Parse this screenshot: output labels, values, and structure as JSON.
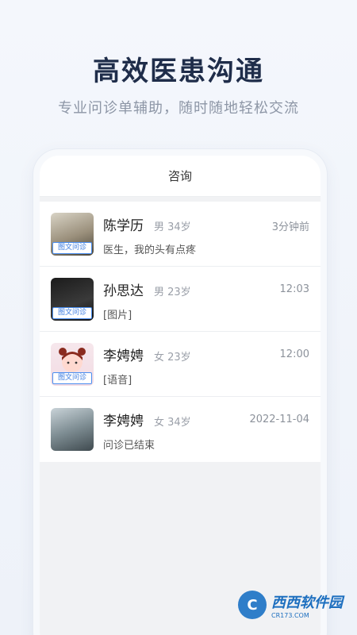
{
  "headline": "高效医患沟通",
  "subline": "专业问诊单辅助，随时随地轻松交流",
  "phone": {
    "nav_title": "咨询",
    "consults": [
      {
        "name": "陈学历",
        "meta": "男 34岁",
        "time": "3分钟前",
        "preview": "医生，我的头有点疼",
        "badge": "图文问诊"
      },
      {
        "name": "孙思达",
        "meta": "男 23岁",
        "time": "12:03",
        "preview": "[图片]",
        "badge": "图文问诊"
      },
      {
        "name": "李娉娉",
        "meta": "女 23岁",
        "time": "12:00",
        "preview": "[语音]",
        "badge": "图文问诊"
      },
      {
        "name": "李娉娉",
        "meta": "女 34岁",
        "time": "2022-11-04",
        "preview": "问诊已结束",
        "badge": ""
      }
    ]
  },
  "watermark": {
    "title": "西西软件园",
    "url": "CR173.COM"
  }
}
